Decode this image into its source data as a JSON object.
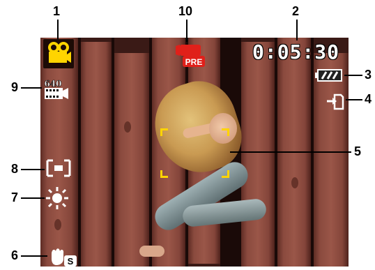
{
  "callouts": {
    "n1": "1",
    "n2": "2",
    "n3": "3",
    "n4": "4",
    "n5": "5",
    "n6": "6",
    "n7": "7",
    "n8": "8",
    "n9": "9",
    "n10": "10"
  },
  "viewfinder": {
    "mode_icon": "video-camera-icon",
    "rec_badge_text": "PRE",
    "timer": "0:05:30",
    "battery_icon": "battery-icon",
    "storage_icon": "memory-card-icon",
    "resolution_label": "640",
    "focus_icon": "focus-frame-icon",
    "white_balance_icon": "sun-icon",
    "stabilizer_label": "S"
  },
  "colors": {
    "accent_yellow": "#ffd400",
    "record_red": "#e0201a",
    "text_white": "#ffffff"
  }
}
